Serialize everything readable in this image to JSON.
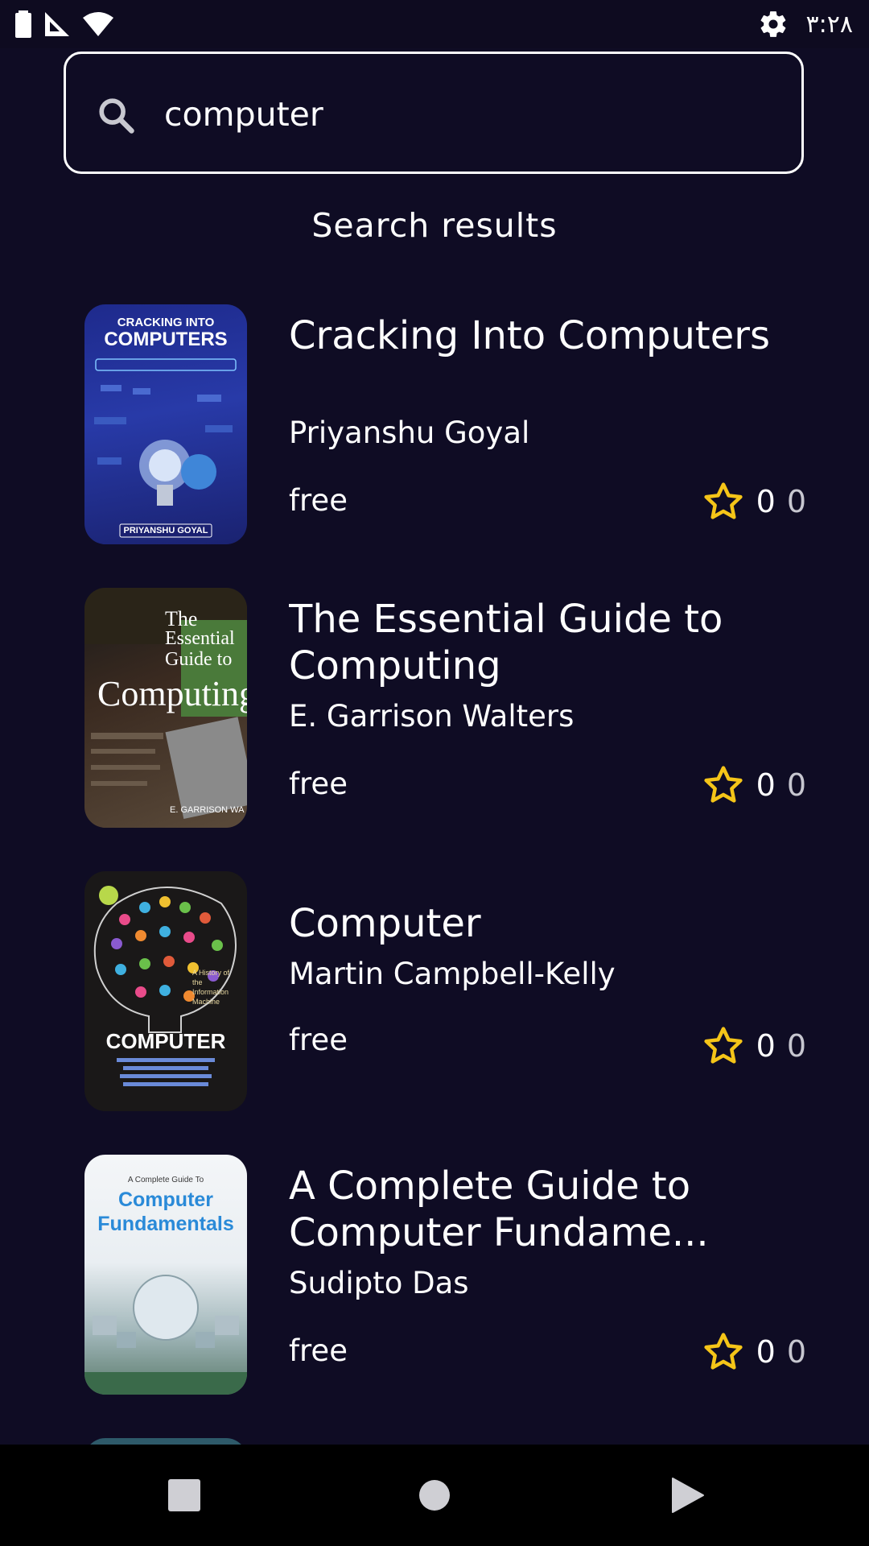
{
  "status_bar": {
    "time": "۳:۲۸"
  },
  "search": {
    "query": "computer"
  },
  "section_title": "Search results",
  "cover_texts": {
    "book1": {
      "top": "CRACKING INTO",
      "main": "COMPUTERS",
      "author": "PRIYANSHU GOYAL"
    },
    "book2": {
      "line1": "The",
      "line2": "Essential",
      "line3": "Guide to",
      "main": "Computing",
      "author": "E. GARRISON WA"
    },
    "book3": {
      "main": "COMPUTER",
      "sub": "A History of the Information Machine"
    },
    "book4": {
      "top": "A Complete Guide To",
      "line1": "Computer",
      "line2": "Fundamentals"
    }
  },
  "books": [
    {
      "title": "Cracking Into Computers",
      "author": "Priyanshu Goyal",
      "price": "free",
      "rating": "0",
      "count": "0"
    },
    {
      "title": "The Essential Guide to Computing",
      "author": "E. Garrison Walters",
      "price": "free",
      "rating": "0",
      "count": "0"
    },
    {
      "title": "Computer",
      "author": "Martin Campbell-Kelly",
      "price": "free",
      "rating": "0",
      "count": "0"
    },
    {
      "title": "A Complete Guide to Computer Fundame...",
      "author": "Sudipto Das",
      "price": "free",
      "rating": "0",
      "count": "0"
    }
  ],
  "colors": {
    "background": "#0f0c24",
    "star": "#f5c518",
    "nav_bar": "#000000"
  },
  "icons": {
    "battery": "battery-icon",
    "signal": "signal-icon",
    "wifi": "wifi-icon",
    "settings": "gear-icon",
    "search": "search-icon",
    "star": "star-outline-icon",
    "recents": "square-icon",
    "home": "circle-icon",
    "back": "triangle-icon"
  }
}
